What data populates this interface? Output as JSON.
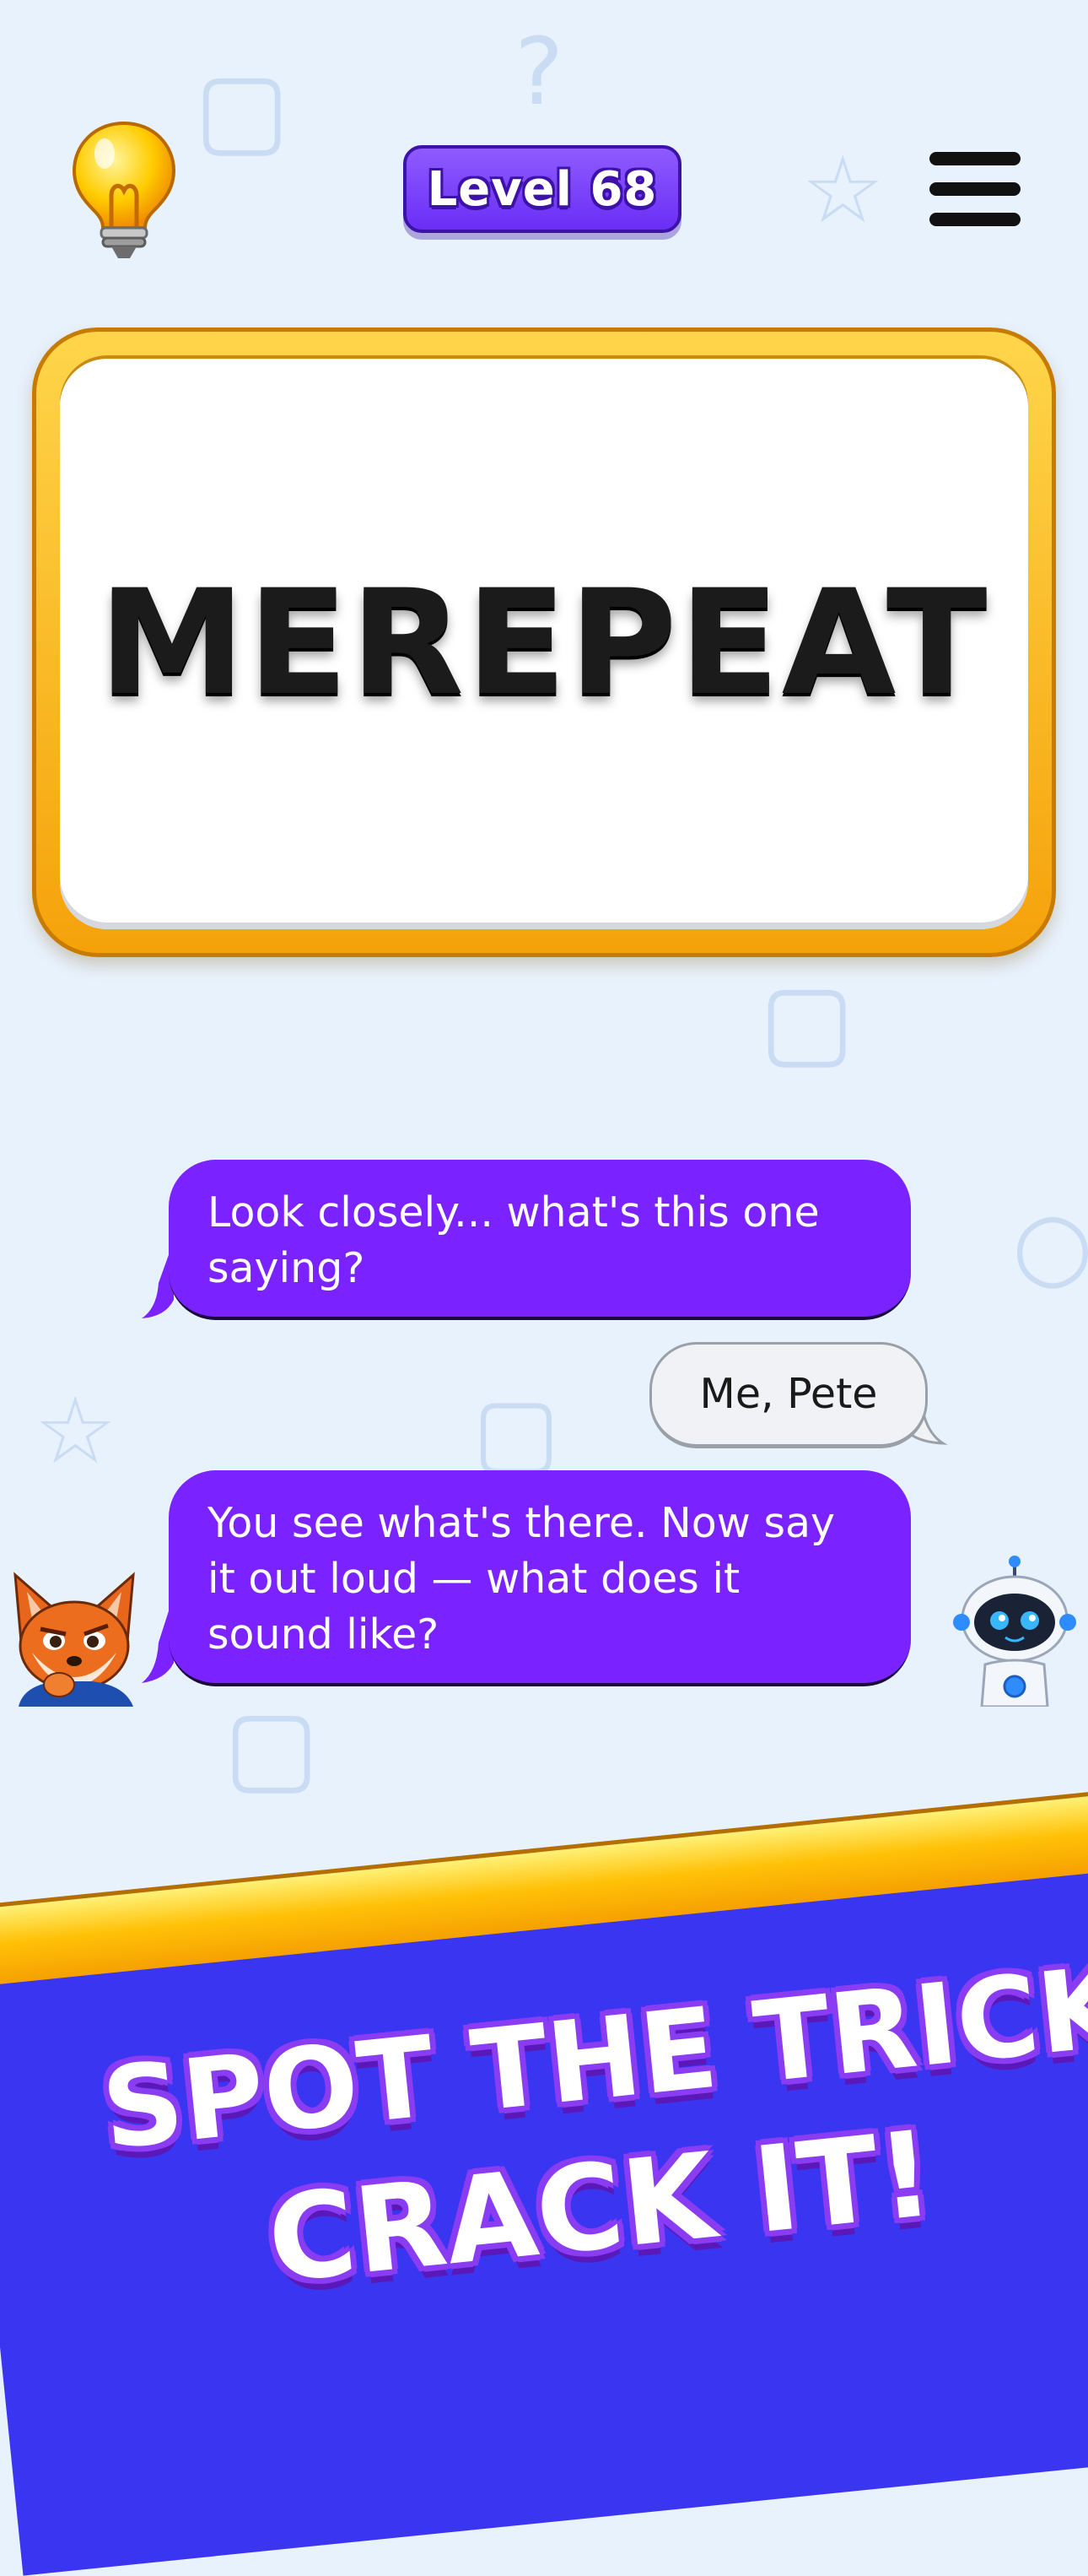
{
  "header": {
    "hint_icon": "lightbulb-icon",
    "level_label": "Level 68",
    "menu_icon": "hamburger-menu-icon"
  },
  "puzzle": {
    "word": "MEREPEAT"
  },
  "chat": {
    "messages": [
      {
        "sender": "fox",
        "text": "Look closely... what's this one saying?"
      },
      {
        "sender": "player",
        "text": "Me, Pete"
      },
      {
        "sender": "fox",
        "text": "You see what's there. Now say it out loud — what does it sound like?"
      }
    ],
    "left_avatar": "fox-avatar",
    "right_avatar": "robot-avatar"
  },
  "banner": {
    "line1": "SPOT THE TRICK.",
    "line2": "CRACK IT!"
  },
  "colors": {
    "background": "#e8f2fd",
    "accent_purple": "#7a22ff",
    "frame_gold": "#ffc107",
    "banner_blue": "#3a35f0"
  }
}
